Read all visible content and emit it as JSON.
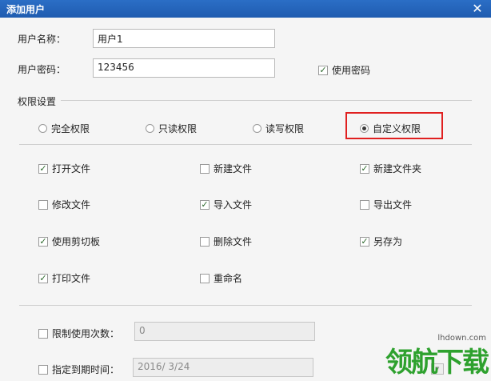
{
  "window": {
    "title": "添加用户",
    "close": "✕"
  },
  "user_name": {
    "label": "用户名称：",
    "value": "用户1"
  },
  "password": {
    "label": "用户密码：",
    "value": "123456"
  },
  "use_password": {
    "label": "使用密码",
    "checked": true
  },
  "permissions": {
    "group_label": "权限设置",
    "modes": [
      {
        "label": "完全权限",
        "selected": false
      },
      {
        "label": "只读权限",
        "selected": false
      },
      {
        "label": "读写权限",
        "selected": false
      },
      {
        "label": "自定义权限",
        "selected": true
      }
    ],
    "items": [
      {
        "label": "打开文件",
        "checked": true
      },
      {
        "label": "新建文件",
        "checked": false
      },
      {
        "label": "新建文件夹",
        "checked": true
      },
      {
        "label": "修改文件",
        "checked": false
      },
      {
        "label": "导入文件",
        "checked": true
      },
      {
        "label": "导出文件",
        "checked": false
      },
      {
        "label": "使用剪切板",
        "checked": true
      },
      {
        "label": "删除文件",
        "checked": false
      },
      {
        "label": "另存为",
        "checked": true
      },
      {
        "label": "打印文件",
        "checked": true
      },
      {
        "label": "重命名",
        "checked": false
      }
    ]
  },
  "limit_uses": {
    "label": "限制使用次数：",
    "checked": false,
    "value": "0"
  },
  "expiry": {
    "label": "指定到期时间：",
    "checked": false,
    "value": "2016/  3/24"
  },
  "watermark": {
    "url": "lhdown.com",
    "text": "领航下载"
  },
  "colors": {
    "titlebar": "#2366be",
    "highlight": "#e02020",
    "watermark": "#2ea12e"
  }
}
